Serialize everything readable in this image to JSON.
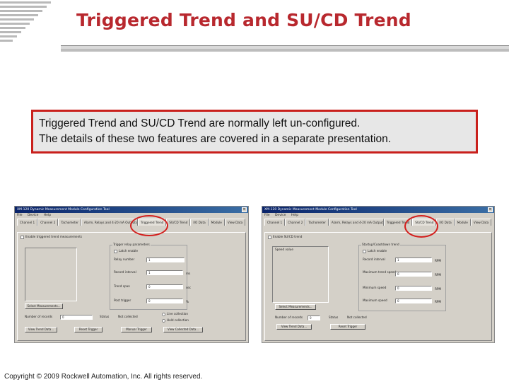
{
  "slide": {
    "title": "Triggered Trend and SU/CD Trend",
    "note_lines": [
      "Triggered Trend and SU/CD Trend are normally left un-configured.",
      "The details of these two features are covered in a separate presentation."
    ],
    "footer": "Copyright © 2009 Rockwell Automation, Inc. All rights reserved."
  },
  "colors": {
    "title": "#b8282e",
    "accent": "#c9201c",
    "note_bg": "#e7e7e7"
  },
  "screenshot_left": {
    "window_title": "XM-120 Dynamic Measurement Module Configuration Tool",
    "menu": [
      "File",
      "Device",
      "Help"
    ],
    "tabs": [
      "Channel 1",
      "Channel 2",
      "Tachometer",
      "Alarm, Relays and 4-20 mA Outputs",
      "Triggered Trend",
      "SU/CD Trend",
      "I/O Data",
      "Module",
      "View Data"
    ],
    "active_tab": "Triggered Trend",
    "enable_label": "Enable triggered trend measurements",
    "group_label": "Trigger relay parameters",
    "latch_label": "Latch enable",
    "relay_number_label": "Relay number",
    "relay_number_value": "1",
    "record_interval_label": "Record interval",
    "record_interval_value": "1",
    "record_interval_unit": "ms",
    "trend_span_label": "Trend span",
    "trend_span_value": "0",
    "trend_span_unit": "sec",
    "post_trigger_label": "Post trigger",
    "post_trigger_value": "0",
    "post_trigger_unit": "%",
    "select_measurements": "Select Measurements...",
    "num_records_label": "Number of records",
    "num_records_value": "0",
    "status_label": "Status",
    "status_value": "Not collected",
    "radio_1": "Live collection",
    "radio_2": "Hold collection",
    "btn_view_trend": "View Trend Data...",
    "btn_reset_trigger": "Reset Trigger",
    "btn_manual_trigger": "Manual Trigger",
    "btn_view_collected": "View Collected Data..."
  },
  "screenshot_right": {
    "window_title": "XM-120 Dynamic Measurement Module Configuration Tool",
    "menu": [
      "File",
      "Device",
      "Help"
    ],
    "tabs": [
      "Channel 1",
      "Channel 2",
      "Tachometer",
      "Alarm, Relays and 4-20 mA Outputs",
      "Triggered Trend",
      "SU/CD Trend",
      "I/O Data",
      "Module",
      "View Data"
    ],
    "active_tab": "SU/CD Trend",
    "enable_label": "Enable SU/CD trend",
    "group_label": "Startup/Coastdown trend",
    "latch_label": "Latch enable",
    "speed_label": "Speed value",
    "record_interval_label": "Record interval",
    "record_interval_value": "1",
    "unit": "RPM",
    "max_trend_label": "Maximum trend speed",
    "max_trend_value": "0",
    "min_speed_label": "Minimum speed",
    "min_speed_value": "0",
    "max_speed_label": "Maximum speed",
    "max_speed_value": "0",
    "select_measurements": "Select Measurements...",
    "num_records_label": "Number of records",
    "num_records_value": "0",
    "status_label": "Status",
    "status_value": "Not collected",
    "btn_view_trend": "View Trend Data...",
    "btn_reset_trigger": "Reset Trigger"
  }
}
